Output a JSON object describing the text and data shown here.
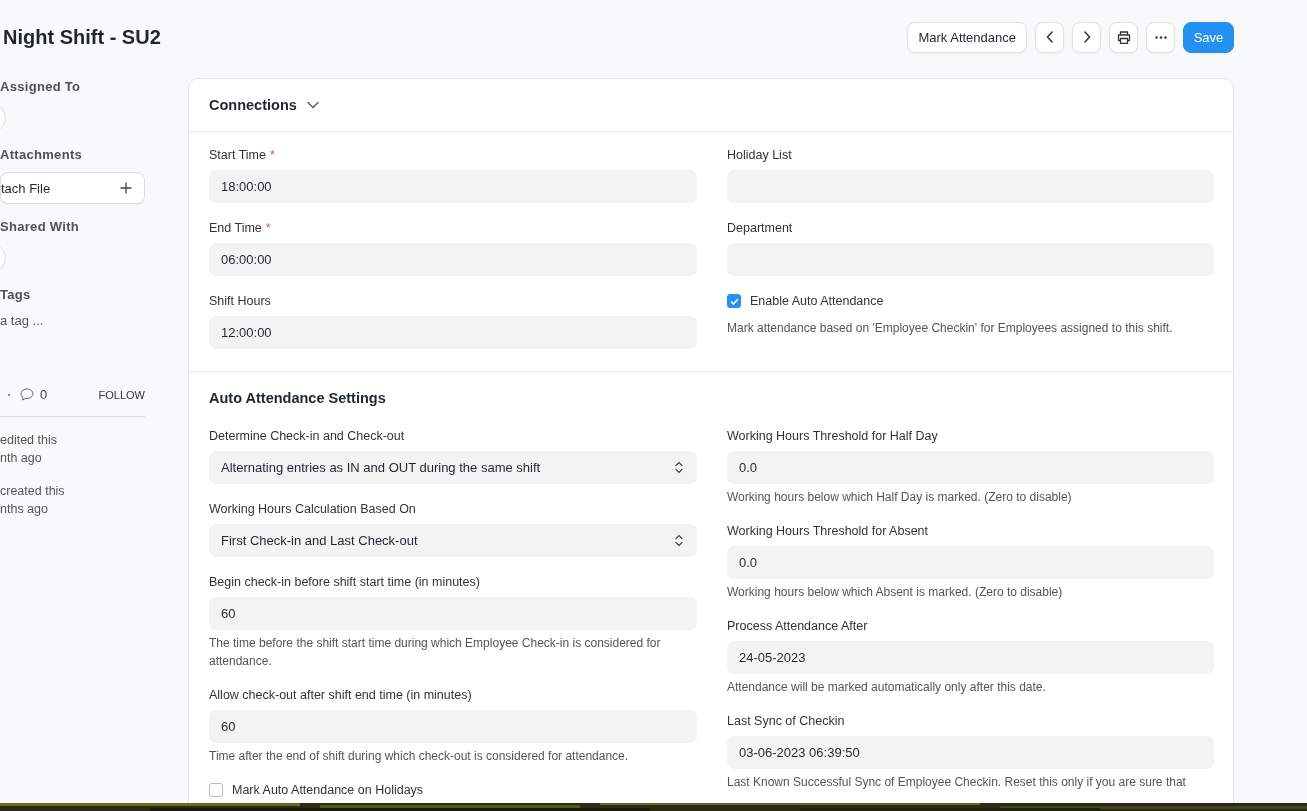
{
  "page": {
    "title": "Night Shift - SU2"
  },
  "actions": [
    {
      "kind": "text",
      "label": "Mark Attendance"
    },
    {
      "kind": "prev"
    },
    {
      "kind": "next"
    },
    {
      "kind": "print"
    },
    {
      "kind": "more"
    },
    {
      "kind": "primary",
      "label": "Save"
    }
  ],
  "sidebar": {
    "sections": [
      {
        "kind": "avatar",
        "heading": "Assigned To"
      },
      {
        "kind": "attach",
        "heading": "Attachments",
        "button": "tach File"
      },
      {
        "kind": "avatar",
        "heading": "Shared With"
      },
      {
        "kind": "tags",
        "heading": "Tags",
        "placeholder": "a tag ..."
      }
    ],
    "comment_count": "0",
    "follow": "FOLLOW",
    "activity": [
      "edited this\nnth ago",
      "created this\nnths ago"
    ]
  },
  "connections": {
    "title": "Connections"
  },
  "sections": [
    {
      "columns": [
        [
          {
            "kind": "data",
            "label": "Start Time",
            "required_mark": "*",
            "value": "18:00:00"
          },
          {
            "kind": "data",
            "label": "End Time",
            "required_mark": "*",
            "value": "06:00:00"
          },
          {
            "kind": "data",
            "label": "Shift Hours",
            "value": "12:00:00"
          }
        ],
        [
          {
            "kind": "data",
            "label": "Holiday List"
          },
          {
            "kind": "data",
            "label": "Department"
          },
          {
            "kind": "check",
            "label": "Enable Auto Attendance",
            "checked": true,
            "description": "Mark attendance based on 'Employee Checkin' for Employees assigned to this shift."
          }
        ]
      ]
    },
    {
      "heading": "Auto Attendance Settings",
      "columns": [
        [
          {
            "kind": "select",
            "label": "Determine Check-in and Check-out",
            "value": "Alternating entries as IN and OUT during the same shift"
          },
          {
            "kind": "select",
            "label": "Working Hours Calculation Based On",
            "value": "First Check-in and Last Check-out"
          },
          {
            "kind": "data",
            "label": "Begin check-in before shift start time (in minutes)",
            "value": "60",
            "description": "The time before the shift start time during which Employee Check-in is considered for attendance."
          },
          {
            "kind": "data",
            "label": "Allow check-out after shift end time (in minutes)",
            "value": "60",
            "description": "Time after the end of shift during which check-out is considered for attendance."
          },
          {
            "kind": "check",
            "label": "Mark Auto Attendance on Holidays",
            "checked": false
          }
        ],
        [
          {
            "kind": "data",
            "label": "Working Hours Threshold for Half Day",
            "value": "0.0",
            "description": "Working hours below which Half Day is marked. (Zero to disable)"
          },
          {
            "kind": "data",
            "label": "Working Hours Threshold for Absent",
            "value": "0.0",
            "description": "Working hours below which Absent is marked. (Zero to disable)"
          },
          {
            "kind": "data",
            "label": "Process Attendance After",
            "value": "24-05-2023",
            "description": "Attendance will be marked automatically only after this date."
          },
          {
            "kind": "data",
            "label": "Last Sync of Checkin",
            "value": "03-06-2023 06:39:50",
            "description": "Last Known Successful Sync of Employee Checkin. Reset this only if you are sure that"
          }
        ]
      ]
    }
  ]
}
